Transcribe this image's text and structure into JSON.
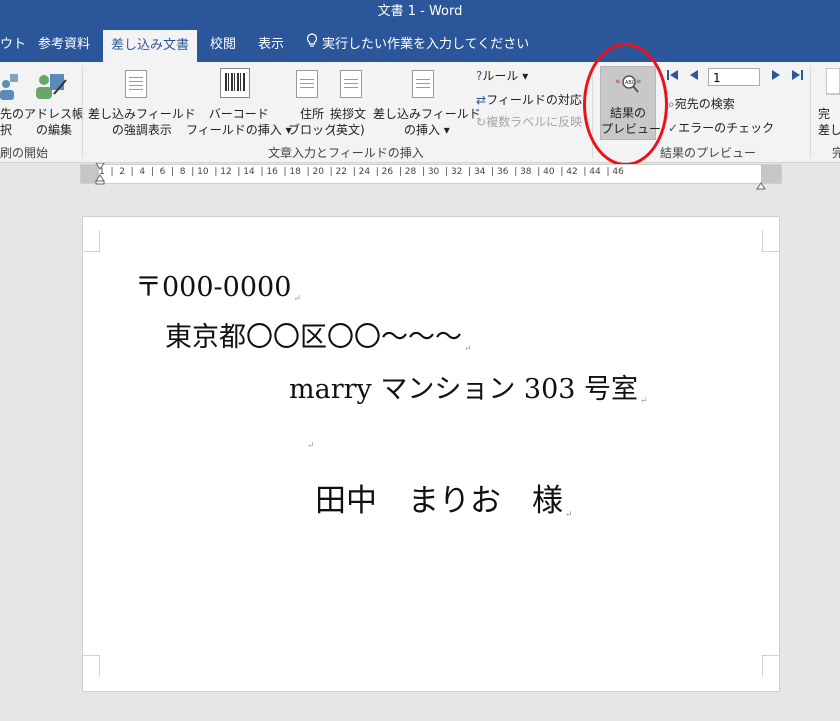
{
  "window": {
    "title": "文書 1  -  Word"
  },
  "tabs": [
    {
      "label": "ウト"
    },
    {
      "label": "参考資料"
    },
    {
      "label": "差し込み文書"
    },
    {
      "label": "校閲"
    },
    {
      "label": "表示"
    }
  ],
  "tellme": {
    "label": "実行したい作業を入力してください"
  },
  "ribbon": {
    "start_group": {
      "recipient_label_line1": "先の",
      "recipient_label_line2": "択",
      "addressbook_line1": "アドレス帳",
      "addressbook_line2": "の編集",
      "group_label": "刷の開始"
    },
    "write_group": {
      "highlight_line1": "差し込みフィールド",
      "highlight_line2": "の強調表示",
      "barcode_line1": "バーコード",
      "barcode_line2": "フィールドの挿入",
      "address_line1": "住所",
      "address_line2": "ブロック",
      "greeting_line1": "挨拶文",
      "greeting_line2": "(英文)",
      "insert_line1": "差し込みフィールド",
      "insert_line2": "の挿入",
      "rules": "ルール",
      "match_fields": "フィールドの対応",
      "update_labels": "複数ラベルに反映",
      "group_label": "文章入力とフィールドの挿入"
    },
    "preview_group": {
      "preview_line1": "結果の",
      "preview_line2": "プレビュー",
      "record_number": "1",
      "find_recipient": "宛先の検索",
      "check_errors": "エラーのチェック",
      "group_label": "結果のプレビュー"
    },
    "finish_group": {
      "finish_line1": "完",
      "finish_line2": "差し",
      "group_label": "完"
    }
  },
  "ruler": {
    "numbers": "1  |  2  |  4  |  6  |  8  | 10  | 12  | 14  | 16  | 18  | 20  | 22  | 24  | 26  | 28  | 30  | 32  | 34  | 36  | 38  | 40  | 42  | 44  | 46"
  },
  "document": {
    "postal": "〒000-0000",
    "address1": "東京都〇〇区〇〇～～～",
    "address2": "marry マンション 303 号室",
    "name": "田中　まりお　様",
    "paragraph_mark": "↵"
  }
}
